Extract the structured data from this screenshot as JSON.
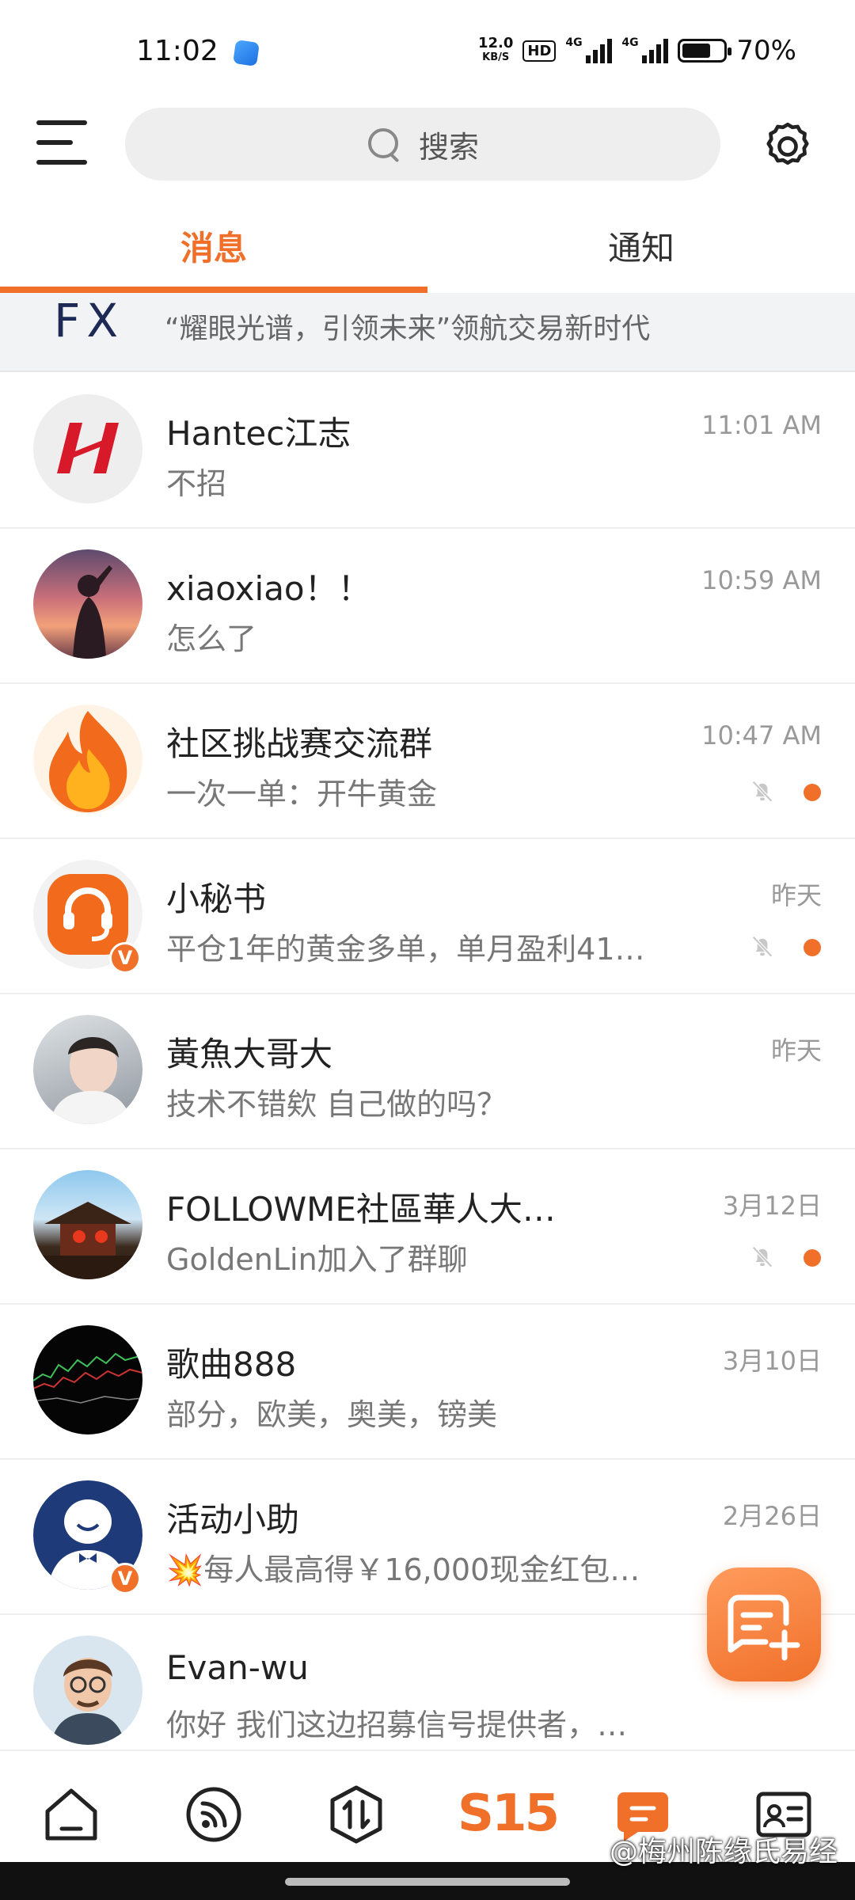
{
  "status_bar": {
    "time": "11:02",
    "net_speed_value": "12.0",
    "net_speed_unit": "KB/S",
    "hd": "HD",
    "signal_tag_1": "4G",
    "signal_tag_2": "4G",
    "battery": "70%",
    "battery_level": 0.7
  },
  "header": {
    "search_placeholder": "搜索"
  },
  "tabs": [
    {
      "label": "消息",
      "active": true
    },
    {
      "label": "通知",
      "active": false
    }
  ],
  "banner": {
    "logo": "FX",
    "text": "“耀眼光谱，引领未来”领航交易新时代"
  },
  "conversations": [
    {
      "name": "Hantec江志",
      "preview": "不招",
      "time": "11:01 AM",
      "muted": false,
      "unread": false,
      "verified": false,
      "avatar": "hantec-logo"
    },
    {
      "name": "xiaoxiao！！",
      "preview": "怎么了",
      "time": "10:59 AM",
      "muted": false,
      "unread": false,
      "verified": false,
      "avatar": "sunset-portrait"
    },
    {
      "name": "社区挑战赛交流群",
      "preview": "一次一单：开牛黄金",
      "time": "10:47 AM",
      "muted": true,
      "unread": true,
      "verified": false,
      "avatar": "flame"
    },
    {
      "name": "小秘书",
      "preview": "平仓1年的黄金多单，单月盈利41…",
      "time": "昨天",
      "muted": true,
      "unread": true,
      "verified": true,
      "avatar": "headset"
    },
    {
      "name": "黃魚大哥大",
      "preview": "技术不错欸 自己做的吗？",
      "time": "昨天",
      "muted": false,
      "unread": false,
      "verified": false,
      "avatar": "portrait"
    },
    {
      "name": "FOLLOWME社區華人大…",
      "preview": "GoldenLin加入了群聊",
      "time": "3月12日",
      "muted": true,
      "unread": true,
      "verified": false,
      "avatar": "pavilion"
    },
    {
      "name": "歌曲888",
      "preview": "部分，欧美，奥美，镑美",
      "time": "3月10日",
      "muted": false,
      "unread": false,
      "verified": false,
      "avatar": "chart"
    },
    {
      "name": "活动小助",
      "preview": "💥每人最高得￥16,000现金红包…",
      "time": "2月26日",
      "muted": false,
      "unread": false,
      "verified": true,
      "avatar": "assistant"
    },
    {
      "name": "Evan-wu",
      "preview": "你好 我们这边招募信号提供者，…",
      "time": "",
      "muted": false,
      "unread": false,
      "verified": false,
      "avatar": "cartoon"
    }
  ],
  "bottom_nav": {
    "s15": "S15"
  },
  "watermark": "@梅州陈缘氏易经",
  "colors": {
    "accent": "#f0702a",
    "text": "#222222",
    "muted_text": "#777777"
  }
}
